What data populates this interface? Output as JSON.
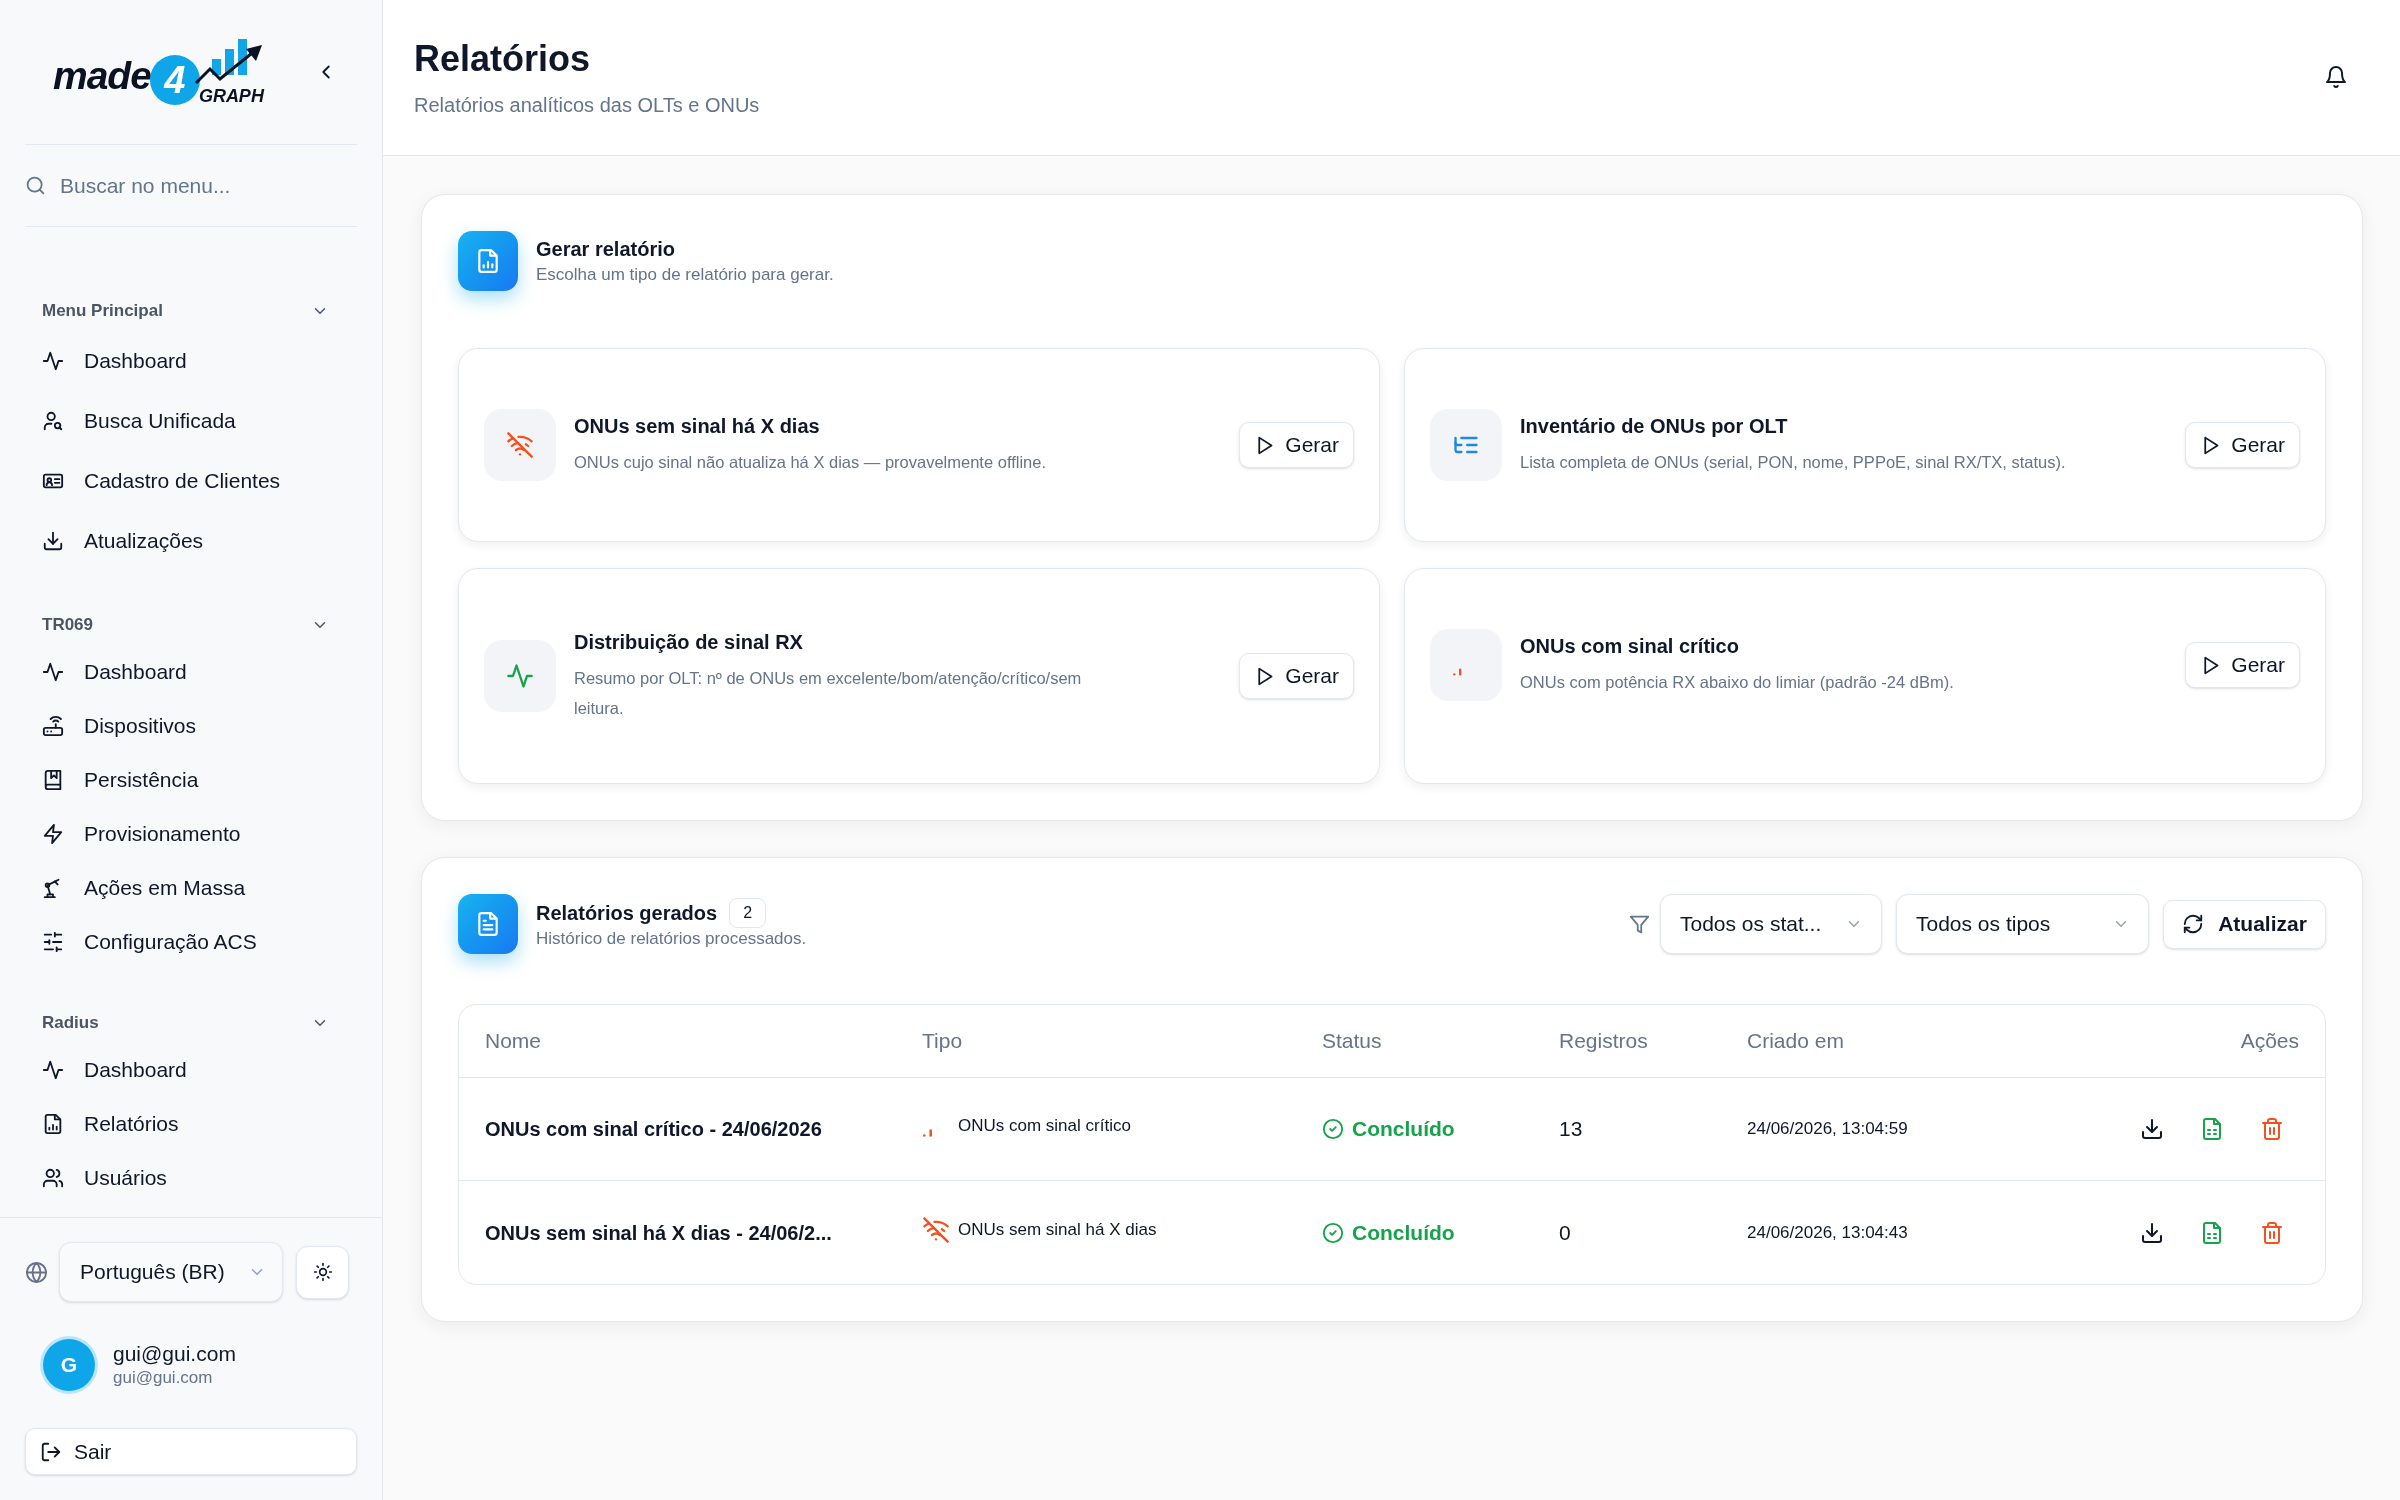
{
  "sidebar": {
    "logo": {
      "wordmark": "made",
      "numeral": "4",
      "tagline": "GRAPH"
    },
    "search": {
      "placeholder": "Buscar no menu..."
    },
    "sections": [
      {
        "title": "Menu Principal",
        "expanded": true,
        "items": [
          "Dashboard",
          "Busca Unificada",
          "Cadastro de Clientes",
          "Atualizações"
        ]
      },
      {
        "title": "TR069",
        "expanded": true,
        "items": [
          "Dashboard",
          "Dispositivos",
          "Persistência",
          "Provisionamento",
          "Ações em Massa",
          "Configuração ACS"
        ]
      },
      {
        "title": "Radius",
        "expanded": true,
        "items": [
          "Dashboard",
          "Relatórios",
          "Usuários"
        ]
      }
    ],
    "language": {
      "value": "Português (BR)"
    },
    "user": {
      "initial": "G",
      "name": "gui@gui.com",
      "email": "gui@gui.com"
    },
    "logout": {
      "label": "Sair"
    }
  },
  "header": {
    "title": "Relatórios",
    "subtitle": "Relatórios analíticos das OLTs e ONUs"
  },
  "generate_panel": {
    "title": "Gerar relatório",
    "subtitle": "Escolha um tipo de relatório para gerar.",
    "reports": [
      {
        "kind": "offline",
        "title": "ONUs sem sinal há X dias",
        "description": "ONUs cujo sinal não atualiza há X dias — provavelmente offline.",
        "button": "Gerar"
      },
      {
        "kind": "inventory",
        "title": "Inventário de ONUs por OLT",
        "description": "Lista completa de ONUs (serial, PON, nome, PPPoE, sinal RX/TX, status).",
        "button": "Gerar"
      },
      {
        "kind": "distribution",
        "title": "Distribuição de sinal RX",
        "description": "Resumo por OLT: nº de ONUs em excelente/bom/atenção/crítico/sem leitura.",
        "button": "Gerar"
      },
      {
        "kind": "critical",
        "title": "ONUs com sinal crítico",
        "description": "ONUs com potência RX abaixo do limiar (padrão -24 dBm).",
        "button": "Gerar"
      }
    ]
  },
  "history_panel": {
    "title": "Relatórios gerados",
    "count": "2",
    "subtitle": "Histórico de relatórios processados.",
    "filters": [
      {
        "value": "Todos os stat..."
      },
      {
        "value": "Todos os tipos"
      }
    ],
    "refresh_button": "Atualizar",
    "table": {
      "columns": [
        "Nome",
        "Tipo",
        "Status",
        "Registros",
        "Criado em",
        "Ações"
      ],
      "rows": [
        {
          "name": "ONUs com sinal crítico - 24/06/2026",
          "type": {
            "kind": "critical",
            "label": "ONUs com sinal crítico"
          },
          "status": {
            "kind": "done",
            "label": "Concluído"
          },
          "records": "13",
          "created": "24/06/2026, 13:04:59"
        },
        {
          "name": "ONUs sem sinal há X dias - 24/06/2...",
          "type": {
            "kind": "offline",
            "label": "ONUs sem sinal há X dias"
          },
          "status": {
            "kind": "done",
            "label": "Concluído"
          },
          "records": "0",
          "created": "24/06/2026, 13:04:43"
        }
      ]
    }
  }
}
